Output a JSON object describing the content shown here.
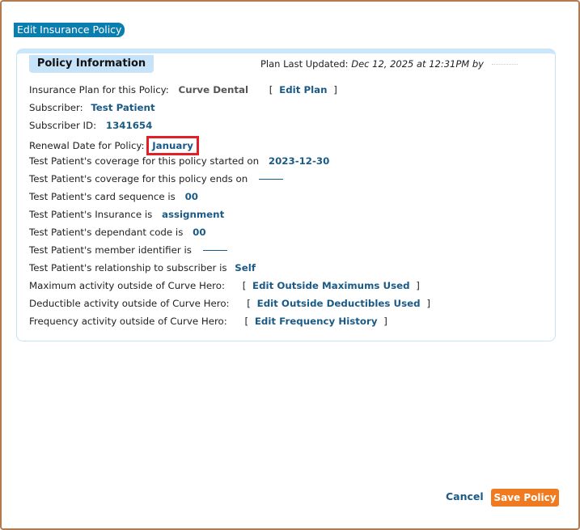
{
  "dialog": {
    "title": "Edit Insurance Policy"
  },
  "policy": {
    "tab_label": "Policy Information",
    "updated_label": "Plan Last Updated:",
    "updated_value": "Dec 12, 2025 at 12:31PM by",
    "plan_label": "Insurance Plan for this Policy:",
    "plan_value": "Curve Dental",
    "edit_plan_label": "Edit Plan",
    "subscriber_label": "Subscriber:",
    "subscriber_value": "Test Patient",
    "subscriber_id_label": "Subscriber ID:",
    "subscriber_id_value": "1341654",
    "renewal_label": "Renewal Date for Policy:",
    "renewal_value": "January",
    "coverage_start_label": "Test Patient's coverage for this policy started on",
    "coverage_start_value": "2023-12-30",
    "coverage_end_label": "Test Patient's coverage for this policy ends on",
    "card_seq_label": "Test Patient's card sequence is",
    "card_seq_value": "00",
    "insurance_label": "Test Patient's Insurance is",
    "insurance_value": "assignment",
    "dependant_label": "Test Patient's dependant code is",
    "dependant_value": "00",
    "member_label": "Test Patient's member identifier is",
    "relationship_label": "Test Patient's relationship to subscriber is",
    "relationship_value": "Self",
    "max_label": "Maximum activity outside of Curve Hero:",
    "max_link": "Edit Outside Maximums Used",
    "deduct_label": "Deductible activity outside of Curve Hero:",
    "deduct_link": "Edit Outside Deductibles Used",
    "freq_label": "Frequency activity outside of Curve Hero:",
    "freq_link": "Edit Frequency History"
  },
  "footer": {
    "cancel_label": "Cancel",
    "save_label": "Save Policy"
  },
  "colors": {
    "accent": "#1a5a86",
    "save": "#f07a1f",
    "highlight": "#e01f26"
  }
}
